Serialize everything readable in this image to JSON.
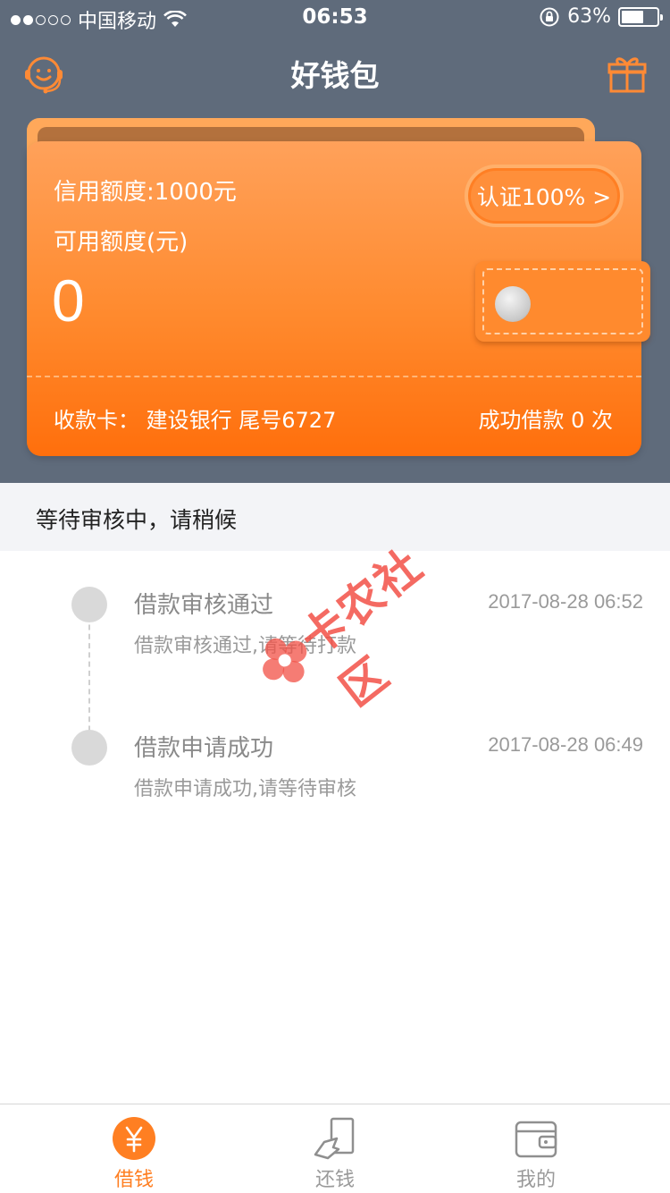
{
  "statusbar": {
    "carrier": "中国移动",
    "time": "06:53",
    "battery": "63%",
    "battery_level": 0.63
  },
  "navbar": {
    "title": "好钱包",
    "left_icon": "customer-service-icon",
    "right_icon": "gift-icon"
  },
  "card": {
    "credit_limit": "信用额度:1000元",
    "available_label": "可用额度(元)",
    "available_value": "0",
    "certification": "认证100% >",
    "bank_card": "收款卡： 建设银行 尾号6727",
    "success_count": "成功借款 0 次"
  },
  "status": {
    "text": "等待审核中，请稍候"
  },
  "timeline": [
    {
      "title": "借款审核通过",
      "subtitle": "借款审核通过,请等待打款",
      "time": "2017-08-28 06:52"
    },
    {
      "title": "借款申请成功",
      "subtitle": "借款申请成功,请等待审核",
      "time": "2017-08-28 06:49"
    }
  ],
  "watermark": {
    "text": "卡农社区"
  },
  "tabs": [
    {
      "label": "借钱",
      "icon": "yen-icon",
      "active": true
    },
    {
      "label": "还钱",
      "icon": "repay-icon",
      "active": false
    },
    {
      "label": "我的",
      "icon": "wallet-icon",
      "active": false
    }
  ],
  "colors": {
    "accent": "#ff7f22",
    "header_bg": "#5f6b7b",
    "card_top": "#ffa15a",
    "card_bottom": "#ff6f0c"
  }
}
